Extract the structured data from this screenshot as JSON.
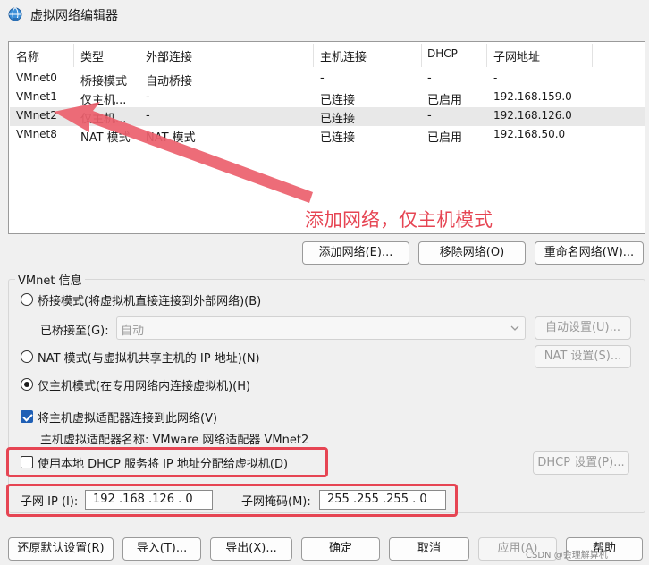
{
  "window": {
    "title": "虚拟网络编辑器",
    "icon": "network-globe-icon"
  },
  "network_table": {
    "columns": [
      "名称",
      "类型",
      "外部连接",
      "主机连接",
      "DHCP",
      "子网地址"
    ],
    "rows": [
      {
        "name": "VMnet0",
        "type": "桥接模式",
        "external": "自动桥接",
        "host": "-",
        "dhcp": "-",
        "subnet": "-"
      },
      {
        "name": "VMnet1",
        "type": "仅主机...",
        "external": "-",
        "host": "已连接",
        "dhcp": "已启用",
        "subnet": "192.168.159.0"
      },
      {
        "name": "VMnet2",
        "type": "仅主机...",
        "external": "-",
        "host": "已连接",
        "dhcp": "-",
        "subnet": "192.168.126.0"
      },
      {
        "name": "VMnet8",
        "type": "NAT 模式",
        "external": "NAT 模式",
        "host": "已连接",
        "dhcp": "已启用",
        "subnet": "192.168.50.0"
      }
    ],
    "selected_row": 2
  },
  "annotation": {
    "text": "添加网络，仅主机模式",
    "color": "#e64553"
  },
  "table_buttons": {
    "add": "添加网络(E)...",
    "remove": "移除网络(O)",
    "rename": "重命名网络(W)..."
  },
  "vmnet_info": {
    "title": "VMnet 信息",
    "bridge_radio": "桥接模式(将虚拟机直接连接到外部网络)(B)",
    "bridged_to_label": "已桥接至(G):",
    "bridged_to_value": "自动",
    "auto_settings": "自动设置(U)...",
    "nat_radio": "NAT 模式(与虚拟机共享主机的 IP 地址)(N)",
    "nat_settings": "NAT 设置(S)...",
    "hostonly_radio": "仅主机模式(在专用网络内连接虚拟机)(H)",
    "connect_adapter": "将主机虚拟适配器连接到此网络(V)",
    "adapter_name": "主机虚拟适配器名称: VMware 网络适配器 VMnet2",
    "use_dhcp": "使用本地 DHCP 服务将 IP 地址分配给虚拟机(D)",
    "dhcp_settings": "DHCP 设置(P)...",
    "subnet_ip_label": "子网 IP (I):",
    "subnet_ip_value": "192 .168 .126 . 0",
    "subnet_mask_label": "子网掩码(M):",
    "subnet_mask_value": "255 .255 .255 . 0"
  },
  "footer": {
    "restore": "还原默认设置(R)",
    "import": "导入(T)...",
    "export": "导出(X)...",
    "ok": "确定",
    "cancel": "取消",
    "apply": "应用(A)",
    "help": "帮助"
  },
  "watermark": "CSDN @会理解算机"
}
